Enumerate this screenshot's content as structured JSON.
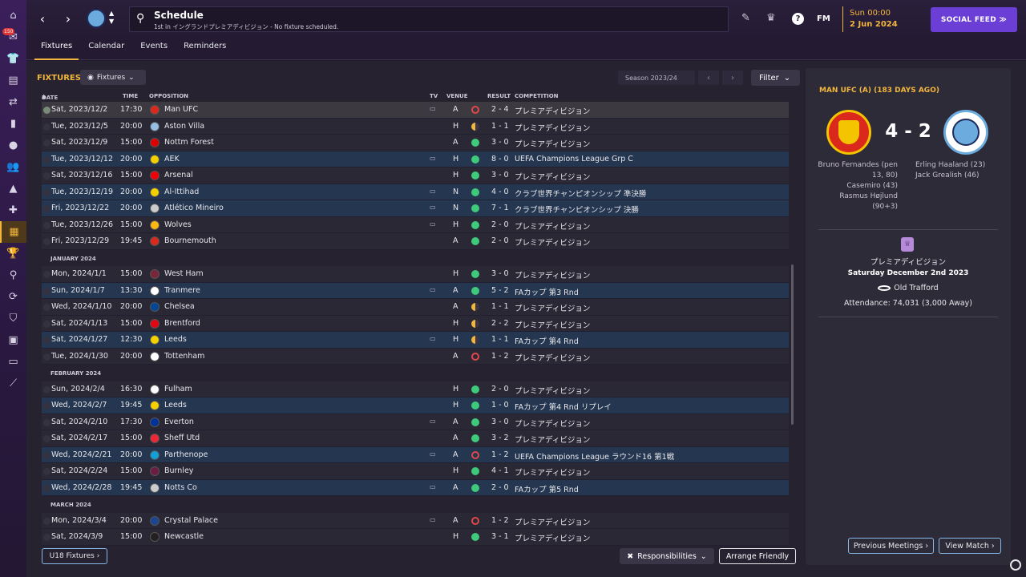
{
  "rail": {
    "badge": "150",
    "items": [
      "home-icon",
      "inbox-icon",
      "squad-icon",
      "tactics-icon",
      "transfers-icon",
      "report-icon",
      "ball-icon",
      "staff-icon",
      "training-icon",
      "medical-icon",
      "schedule-icon",
      "trophy-icon",
      "search-icon",
      "swap-icon",
      "shield-icon",
      "finance-icon",
      "ticket-icon",
      "graph-icon"
    ]
  },
  "topbar": {
    "title": "Schedule",
    "subtitle": "1st in イングランドプレミアディビジョン - No fixture scheduled.",
    "help": "?",
    "fm": "FM",
    "time": "Sun 00:00",
    "date": "2 Jun 2024",
    "social_feed": "SOCIAL FEED  ≫"
  },
  "tabs": [
    "Fixtures",
    "Calendar",
    "Events",
    "Reminders"
  ],
  "fixtures": {
    "heading": "FIXTURES",
    "view_dropdown": "Fixtures",
    "season": "Season 2023/24",
    "filter": "Filter",
    "columns": {
      "date": "DATE",
      "time": "TIME",
      "opposition": "OPPOSITION",
      "tv": "TV",
      "venue": "VENUE",
      "result": "RESULT",
      "competition": "COMPETITION"
    },
    "rows": [
      {
        "type": "match",
        "date": "Sat, 2023/12/2",
        "time": "17:30",
        "opp": "Man UFC",
        "crest": "#da291c",
        "tv": true,
        "venue": "A",
        "res": "L",
        "score": "2 - 4",
        "comp": "プレミアディビジョン",
        "hl": false,
        "first": true
      },
      {
        "type": "match",
        "date": "Tue, 2023/12/5",
        "time": "20:00",
        "opp": "Aston Villa",
        "crest": "#95bfe5",
        "tv": false,
        "venue": "H",
        "res": "D",
        "score": "1 - 1",
        "comp": "プレミアディビジョン",
        "hl": false
      },
      {
        "type": "match",
        "date": "Sat, 2023/12/9",
        "time": "15:00",
        "opp": "Nottm Forest",
        "crest": "#dd0000",
        "tv": false,
        "venue": "A",
        "res": "W",
        "score": "3 - 0",
        "comp": "プレミアディビジョン",
        "hl": false
      },
      {
        "type": "match",
        "date": "Tue, 2023/12/12",
        "time": "20:00",
        "opp": "AEK",
        "crest": "#f5d000",
        "tv": true,
        "venue": "H",
        "res": "W",
        "score": "8 - 0",
        "comp": "UEFA Champions League Grp C",
        "hl": true
      },
      {
        "type": "match",
        "date": "Sat, 2023/12/16",
        "time": "15:00",
        "opp": "Arsenal",
        "crest": "#ef0107",
        "tv": false,
        "venue": "H",
        "res": "W",
        "score": "3 - 0",
        "comp": "プレミアディビジョン",
        "hl": false
      },
      {
        "type": "match",
        "date": "Tue, 2023/12/19",
        "time": "20:00",
        "opp": "Al-Ittihad",
        "crest": "#f5d000",
        "tv": true,
        "venue": "N",
        "res": "W",
        "score": "4 - 0",
        "comp": "クラブ世界チャンピオンシップ 準決勝",
        "hl": true
      },
      {
        "type": "match",
        "date": "Fri, 2023/12/22",
        "time": "20:00",
        "opp": "Atlético Mineiro",
        "crest": "#cccccc",
        "tv": true,
        "venue": "N",
        "res": "W",
        "score": "7 - 1",
        "comp": "クラブ世界チャンピオンシップ 決勝",
        "hl": true
      },
      {
        "type": "match",
        "date": "Tue, 2023/12/26",
        "time": "15:00",
        "opp": "Wolves",
        "crest": "#fdb913",
        "tv": true,
        "venue": "H",
        "res": "W",
        "score": "2 - 0",
        "comp": "プレミアディビジョン",
        "hl": false
      },
      {
        "type": "match",
        "date": "Fri, 2023/12/29",
        "time": "19:45",
        "opp": "Bournemouth",
        "crest": "#da291c",
        "tv": false,
        "venue": "A",
        "res": "W",
        "score": "2 - 0",
        "comp": "プレミアディビジョン",
        "hl": false
      },
      {
        "type": "month",
        "label": "JANUARY 2024"
      },
      {
        "type": "match",
        "date": "Mon, 2024/1/1",
        "time": "15:00",
        "opp": "West Ham",
        "crest": "#7a263a",
        "tv": false,
        "venue": "H",
        "res": "W",
        "score": "3 - 0",
        "comp": "プレミアディビジョン",
        "hl": false
      },
      {
        "type": "match",
        "date": "Sun, 2024/1/7",
        "time": "13:30",
        "opp": "Tranmere",
        "crest": "#ffffff",
        "tv": true,
        "venue": "A",
        "res": "W",
        "score": "5 - 2",
        "comp": "FAカップ 第3 Rnd",
        "hl": true
      },
      {
        "type": "match",
        "date": "Wed, 2024/1/10",
        "time": "20:00",
        "opp": "Chelsea",
        "crest": "#034694",
        "tv": false,
        "venue": "A",
        "res": "D",
        "score": "1 - 1",
        "comp": "プレミアディビジョン",
        "hl": false
      },
      {
        "type": "match",
        "date": "Sat, 2024/1/13",
        "time": "15:00",
        "opp": "Brentford",
        "crest": "#e30613",
        "tv": false,
        "venue": "H",
        "res": "D",
        "score": "2 - 2",
        "comp": "プレミアディビジョン",
        "hl": false
      },
      {
        "type": "match",
        "date": "Sat, 2024/1/27",
        "time": "12:30",
        "opp": "Leeds",
        "crest": "#f5d000",
        "tv": true,
        "venue": "H",
        "res": "D",
        "score": "1 - 1",
        "comp": "FAカップ 第4 Rnd",
        "hl": true
      },
      {
        "type": "match",
        "date": "Tue, 2024/1/30",
        "time": "20:00",
        "opp": "Tottenham",
        "crest": "#ffffff",
        "tv": false,
        "venue": "A",
        "res": "L",
        "score": "1 - 2",
        "comp": "プレミアディビジョン",
        "hl": false
      },
      {
        "type": "month",
        "label": "FEBRUARY 2024"
      },
      {
        "type": "match",
        "date": "Sun, 2024/2/4",
        "time": "16:30",
        "opp": "Fulham",
        "crest": "#ffffff",
        "tv": false,
        "venue": "H",
        "res": "W",
        "score": "2 - 0",
        "comp": "プレミアディビジョン",
        "hl": false
      },
      {
        "type": "match",
        "date": "Wed, 2024/2/7",
        "time": "19:45",
        "opp": "Leeds",
        "crest": "#f5d000",
        "tv": false,
        "venue": "H",
        "res": "W",
        "score": "1 - 0",
        "comp": "FAカップ 第4 Rnd リプレイ",
        "hl": true
      },
      {
        "type": "match",
        "date": "Sat, 2024/2/10",
        "time": "17:30",
        "opp": "Everton",
        "crest": "#003399",
        "tv": true,
        "venue": "A",
        "res": "W",
        "score": "3 - 0",
        "comp": "プレミアディビジョン",
        "hl": false
      },
      {
        "type": "match",
        "date": "Sat, 2024/2/17",
        "time": "15:00",
        "opp": "Sheff Utd",
        "crest": "#ee2737",
        "tv": false,
        "venue": "A",
        "res": "W",
        "score": "3 - 2",
        "comp": "プレミアディビジョン",
        "hl": false
      },
      {
        "type": "match",
        "date": "Wed, 2024/2/21",
        "time": "20:00",
        "opp": "Parthenope",
        "crest": "#12a0d7",
        "tv": true,
        "venue": "A",
        "res": "L",
        "score": "1 - 2",
        "comp": "UEFA Champions League ラウンド16 第1戦",
        "hl": true
      },
      {
        "type": "match",
        "date": "Sat, 2024/2/24",
        "time": "15:00",
        "opp": "Burnley",
        "crest": "#6c1d45",
        "tv": false,
        "venue": "H",
        "res": "W",
        "score": "4 - 1",
        "comp": "プレミアディビジョン",
        "hl": false
      },
      {
        "type": "match",
        "date": "Wed, 2024/2/28",
        "time": "19:45",
        "opp": "Notts Co",
        "crest": "#cccccc",
        "tv": true,
        "venue": "A",
        "res": "W",
        "score": "2 - 0",
        "comp": "FAカップ 第5 Rnd",
        "hl": true
      },
      {
        "type": "month",
        "label": "MARCH 2024"
      },
      {
        "type": "match",
        "date": "Mon, 2024/3/4",
        "time": "20:00",
        "opp": "Crystal Palace",
        "crest": "#1b458f",
        "tv": true,
        "venue": "A",
        "res": "L",
        "score": "1 - 2",
        "comp": "プレミアディビジョン",
        "hl": false
      },
      {
        "type": "match",
        "date": "Sat, 2024/3/9",
        "time": "15:00",
        "opp": "Newcastle",
        "crest": "#241f20",
        "tv": false,
        "venue": "H",
        "res": "W",
        "score": "3 - 1",
        "comp": "プレミアディビジョン",
        "hl": false
      }
    ],
    "u18": "U18 Fixtures ›",
    "responsibilities": "Responsibilities",
    "arrange_friendly": "Arrange Friendly"
  },
  "match_panel": {
    "title": "MAN UFC (A) (183 DAYS AGO)",
    "score": "4 - 2",
    "home_scorers": [
      "Bruno Fernandes (pen 13, 80)",
      "Casemiro (43)",
      "Rasmus Højlund (90+3)"
    ],
    "away_scorers": [
      "Erling Haaland (23)",
      "Jack Grealish (46)"
    ],
    "competition": "プレミアディビジョン",
    "date": "Saturday December 2nd 2023",
    "stadium": "Old Trafford",
    "attendance": "Attendance: 74,031 (3,000 Away)",
    "previous_meetings": "Previous Meetings ›",
    "view_match": "View Match ›"
  }
}
